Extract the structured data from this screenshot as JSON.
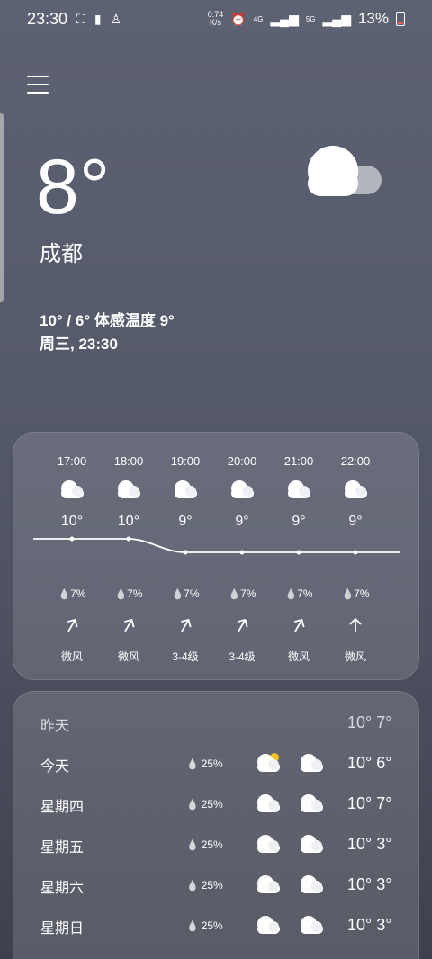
{
  "status_bar": {
    "time": "23:30",
    "net_speed_value": "0.74",
    "net_speed_unit": "K/s",
    "signal_1": "4G",
    "signal_2": "5G",
    "battery": "13%"
  },
  "current": {
    "temp": "8°",
    "city": "成都",
    "range": "10° / 6° 体感温度 9°",
    "datetime": "周三, 23:30",
    "icon": "cloud-icon"
  },
  "hourly": [
    {
      "time": "17:00",
      "temp": "10°",
      "rain": "7%",
      "wind": "微风",
      "icon": "cloud-icon"
    },
    {
      "time": "18:00",
      "temp": "10°",
      "rain": "7%",
      "wind": "微风",
      "icon": "cloud-icon"
    },
    {
      "time": "19:00",
      "temp": "9°",
      "rain": "7%",
      "wind": "3-4级",
      "icon": "cloud-icon"
    },
    {
      "time": "20:00",
      "temp": "9°",
      "rain": "7%",
      "wind": "3-4级",
      "icon": "cloud-icon"
    },
    {
      "time": "21:00",
      "temp": "9°",
      "rain": "7%",
      "wind": "微风",
      "icon": "cloud-icon"
    },
    {
      "time": "22:00",
      "temp": "9°",
      "rain": "7%",
      "wind": "微风",
      "icon": "cloud-icon"
    }
  ],
  "daily": [
    {
      "day": "昨天",
      "rain": "",
      "temps": "10° 7°",
      "icons": []
    },
    {
      "day": "今天",
      "rain": "25%",
      "temps": "10° 6°",
      "icons": [
        "partly-cloudy-icon",
        "cloud-icon"
      ]
    },
    {
      "day": "星期四",
      "rain": "25%",
      "temps": "10° 7°",
      "icons": [
        "cloud-icon",
        "cloud-icon"
      ]
    },
    {
      "day": "星期五",
      "rain": "25%",
      "temps": "10° 3°",
      "icons": [
        "cloud-icon",
        "cloud-icon"
      ]
    },
    {
      "day": "星期六",
      "rain": "25%",
      "temps": "10° 3°",
      "icons": [
        "cloud-icon",
        "cloud-icon"
      ]
    },
    {
      "day": "星期日",
      "rain": "25%",
      "temps": "10° 3°",
      "icons": [
        "cloud-icon",
        "cloud-icon"
      ]
    }
  ],
  "colors": {
    "sun": "#f5c21b",
    "battery_low": "#ff5a5a"
  }
}
